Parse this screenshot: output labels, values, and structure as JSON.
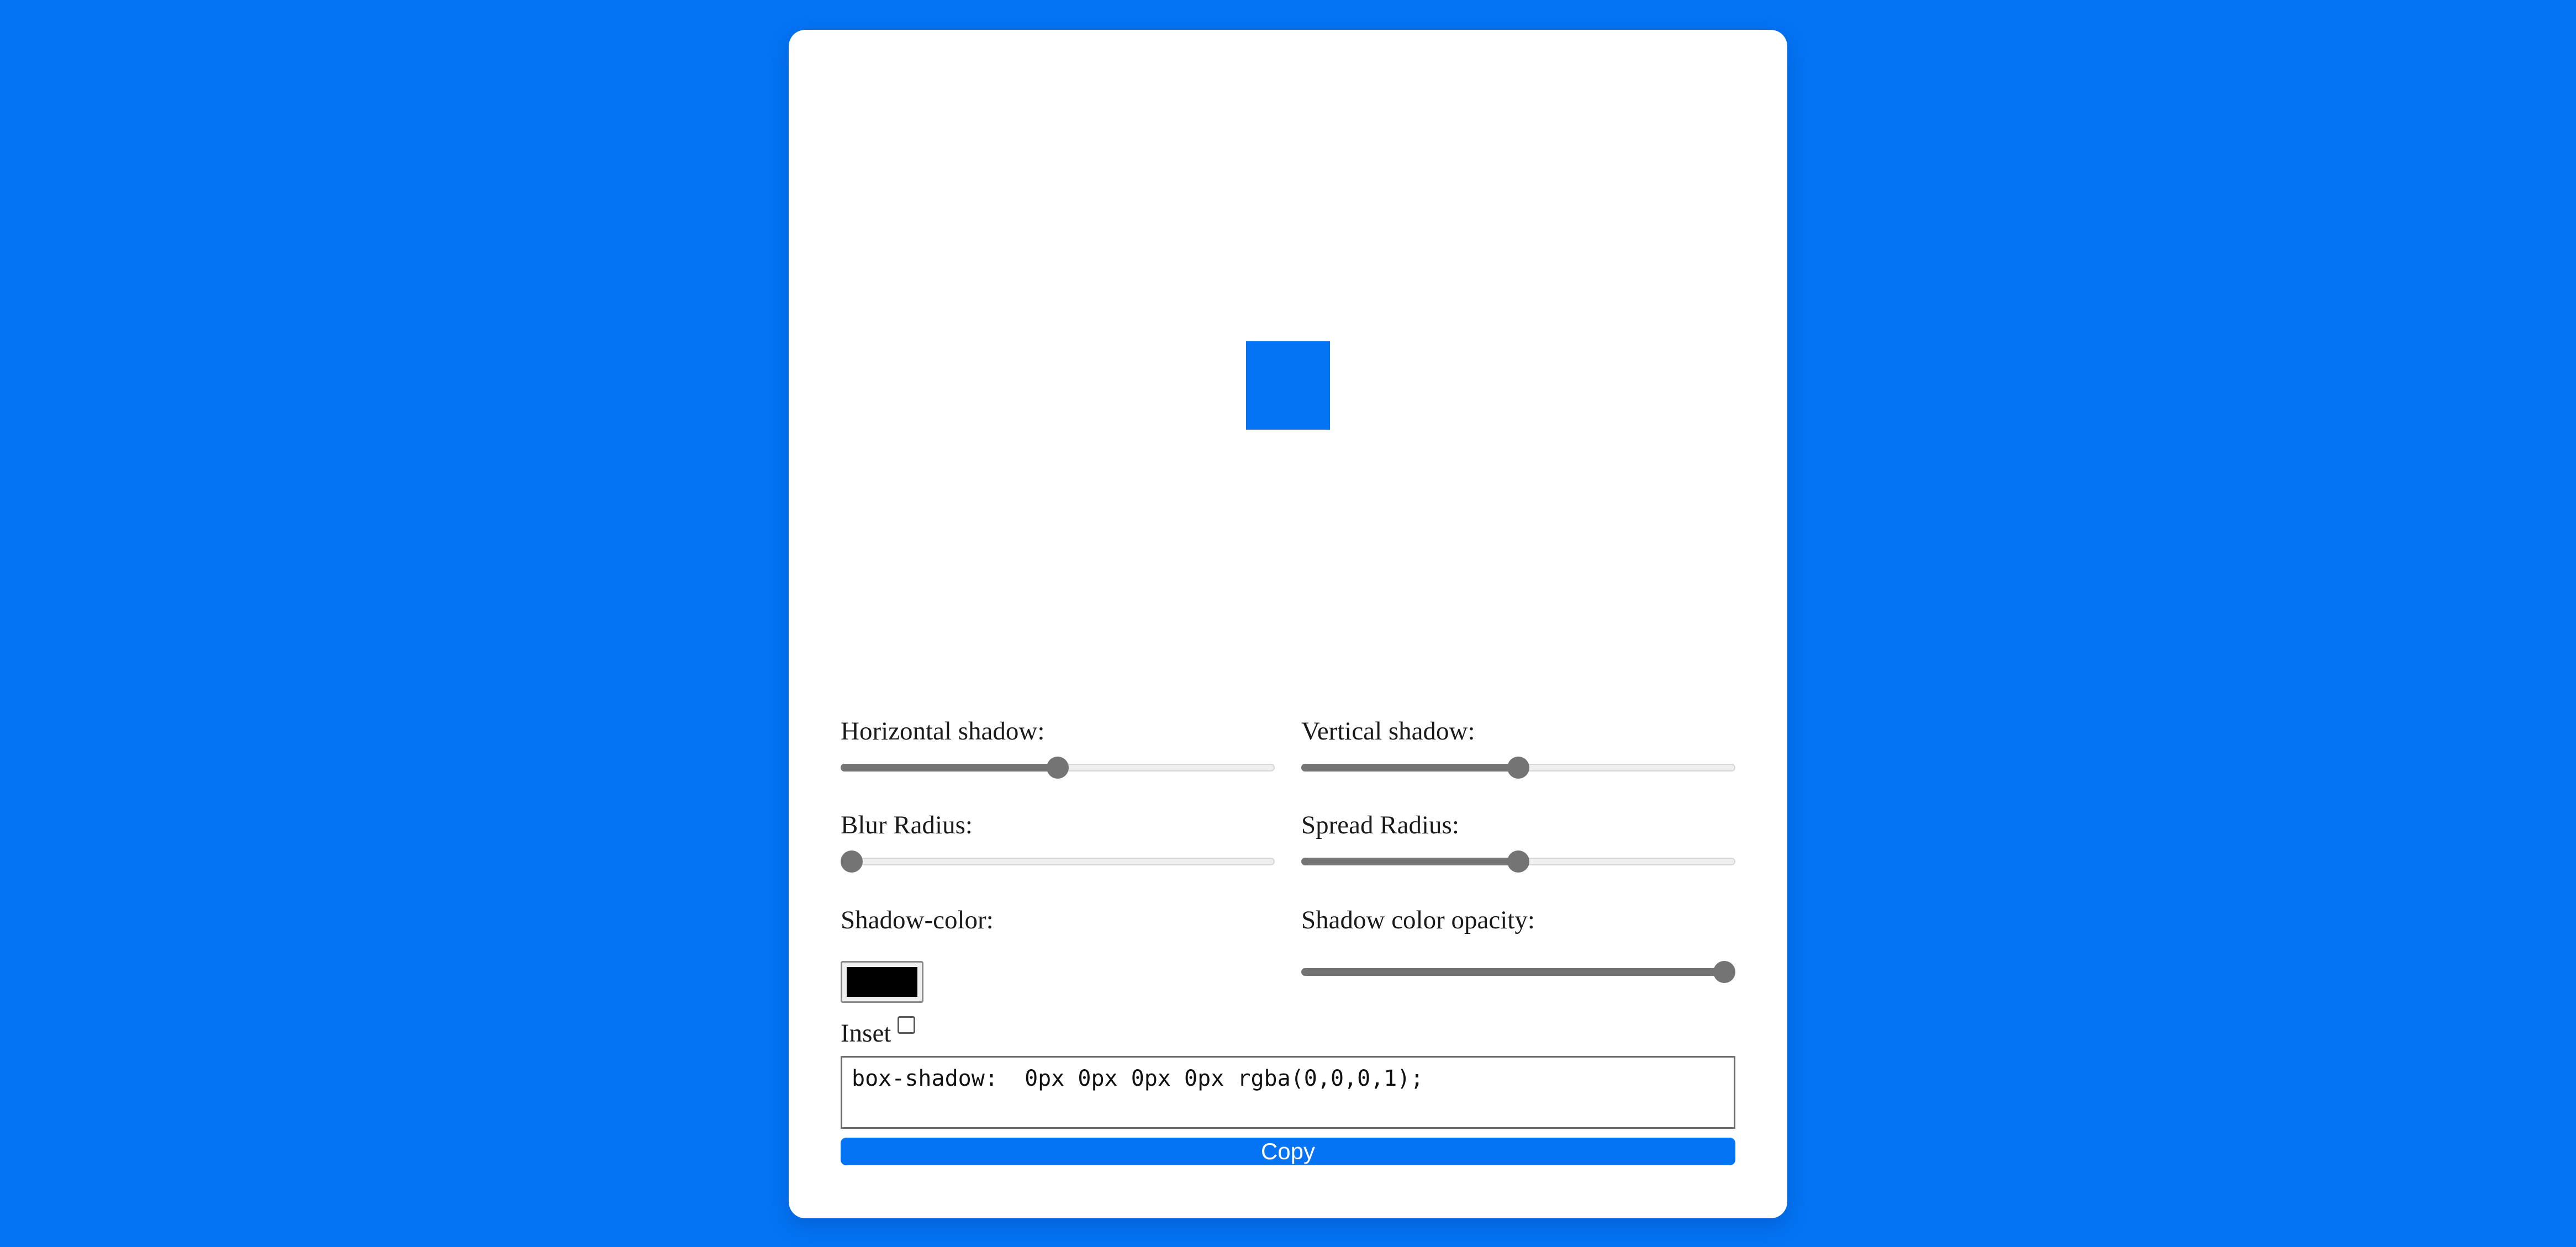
{
  "theme": {
    "background": "#0474f4",
    "card_background": "#ffffff",
    "preview_color": "#0474f4",
    "button_color": "#0474f4",
    "slider_color": "#747474"
  },
  "controls": {
    "horizontal_shadow": {
      "label": "Horizontal shadow:",
      "value": 0,
      "min": -100,
      "max": 100
    },
    "vertical_shadow": {
      "label": "Vertical shadow:",
      "value": 0,
      "min": -100,
      "max": 100
    },
    "blur_radius": {
      "label": "Blur Radius:",
      "value": 0,
      "min": 0,
      "max": 100
    },
    "spread_radius": {
      "label": "Spread Radius:",
      "value": 0,
      "min": -100,
      "max": 100
    },
    "shadow_color": {
      "label": "Shadow-color:",
      "value": "#000000"
    },
    "shadow_opacity": {
      "label": "Shadow color opacity:",
      "value": 1,
      "min": 0,
      "max": 1
    },
    "inset": {
      "label": "Inset",
      "checked": false
    }
  },
  "output": {
    "code": "box-shadow:  0px 0px 0px 0px rgba(0,0,0,1);"
  },
  "copy_button": {
    "label": "Copy"
  }
}
